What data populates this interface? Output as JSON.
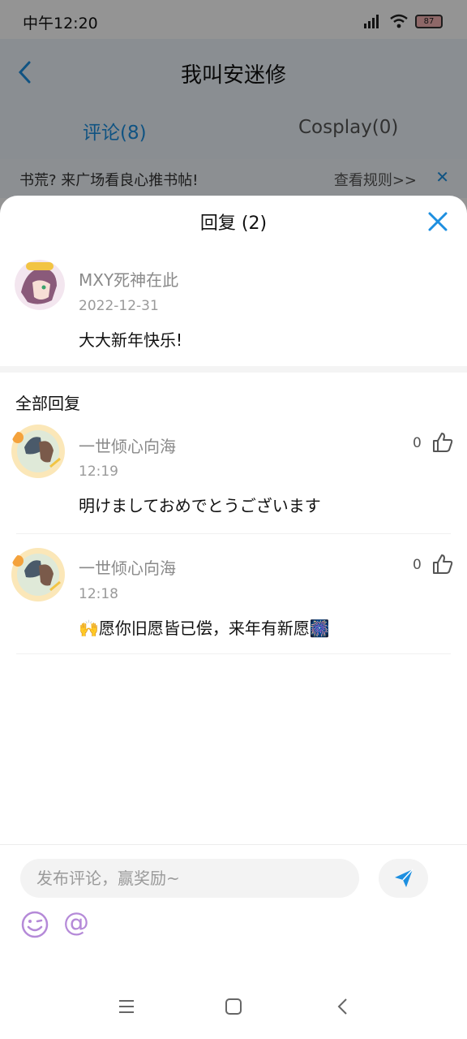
{
  "status_bar": {
    "time": "中午12:20",
    "battery": "87"
  },
  "header": {
    "title": "我叫安迷修"
  },
  "tabs": [
    {
      "label": "评论(8)",
      "active": true
    },
    {
      "label": "Cosplay(0)",
      "active": false
    }
  ],
  "notice": {
    "text": "书荒? 来广场看良心推书帖!",
    "link": "查看规则>>",
    "close": "✕"
  },
  "sheet": {
    "title": "回复 (2)"
  },
  "original_comment": {
    "user": "MXY死神在此",
    "date": "2022-12-31",
    "content": "大大新年快乐!"
  },
  "section_label": "全部回复",
  "replies": [
    {
      "user": "一世倾心向海",
      "time": "12:19",
      "content": "明けましておめでとうございます",
      "likes": "0"
    },
    {
      "user": "一世倾心向海",
      "time": "12:18",
      "content": "🙌愿你旧愿皆已偿，来年有新愿🎆",
      "likes": "0"
    }
  ],
  "input": {
    "placeholder": "发布评论，赢奖励~",
    "value": ""
  },
  "colors": {
    "accent": "#1d8fe0",
    "emoji_purple": "#b58ad8"
  },
  "icons": [
    "back-icon",
    "close-icon",
    "like-icon",
    "send-icon",
    "emoji-icon",
    "at-icon",
    "menu-icon",
    "home-icon",
    "nav-back-icon"
  ]
}
